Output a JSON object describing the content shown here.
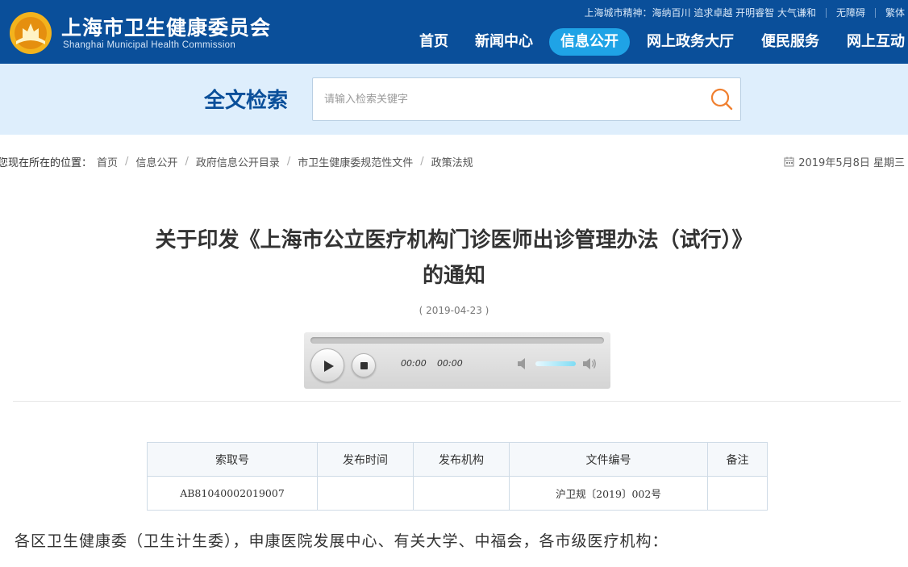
{
  "header": {
    "site_title": "上海市卫生健康委员会",
    "site_subtitle": "Shanghai Municipal Health Commission",
    "city_spirit": "上海城市精神：海纳百川 追求卓越 开明睿智 大气谦和",
    "accessibility_label": "无障碍",
    "traditional_label": "繁体",
    "nav": {
      "home": "首页",
      "news": "新闻中心",
      "info": "信息公开",
      "hall": "网上政务大厅",
      "service": "便民服务",
      "interact": "网上互动"
    }
  },
  "search": {
    "title": "全文检索",
    "placeholder": "请输入检索关键字"
  },
  "breadcrumb": {
    "lead": "您现在所在的位置：",
    "items": [
      "首页",
      "信息公开",
      "政府信息公开目录",
      "市卫生健康委规范性文件",
      "政策法规"
    ]
  },
  "date_display": "2019年5月8日 星期三",
  "article": {
    "title_line1": "关于印发《上海市公立医疗机构门诊医师出诊管理办法（试行）》",
    "title_line2": "的通知",
    "publish_date": "( 2019-04-23 )"
  },
  "player": {
    "current_time": "00:00",
    "total_time": "00:00",
    "progress_percent": 0,
    "volume_percent": 100
  },
  "meta_table": {
    "headers": [
      "索取号",
      "发布时间",
      "发布机构",
      "文件编号",
      "备注"
    ],
    "row": [
      "AB81040002019007",
      "",
      "",
      "沪卫规〔2019〕002号",
      ""
    ]
  },
  "body": {
    "salutation": "各区卫生健康委（卫生计生委），申康医院发展中心、有关大学、中福会，各市级医疗机构："
  },
  "colors": {
    "header_blue": "#0a4f9a",
    "nav_active": "#1fa3e6",
    "search_band": "#deeefc",
    "search_icon": "#f08030"
  }
}
